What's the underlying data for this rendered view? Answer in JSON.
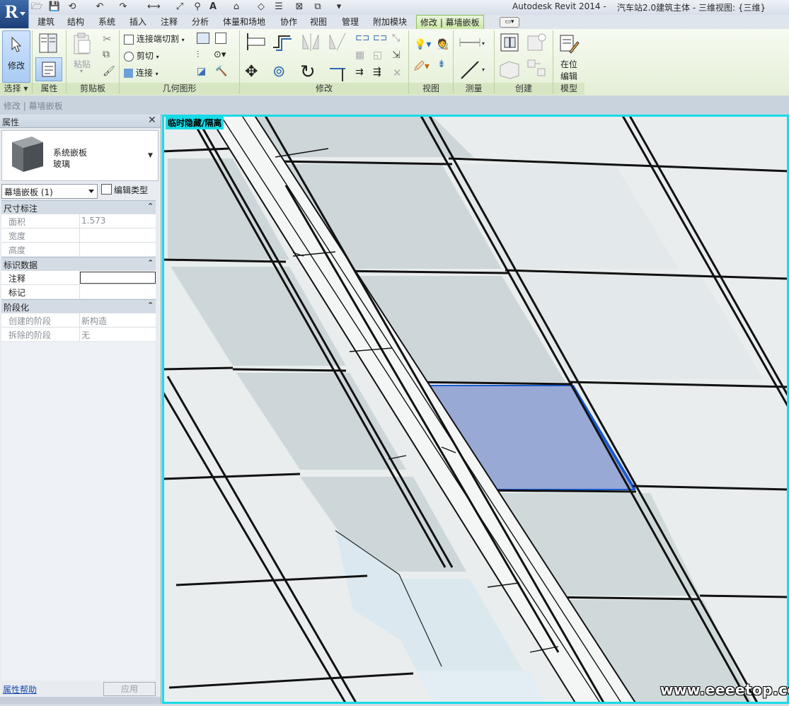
{
  "window": {
    "app_title": "Autodesk Revit 2014 -",
    "file_title": "汽车站2.0建筑主体 - 三维视图: {三维}"
  },
  "app_button": {
    "letter": "R"
  },
  "tabs": [
    {
      "label": "建筑"
    },
    {
      "label": "结构"
    },
    {
      "label": "系统"
    },
    {
      "label": "插入"
    },
    {
      "label": "注释"
    },
    {
      "label": "分析"
    },
    {
      "label": "体量和场地"
    },
    {
      "label": "协作"
    },
    {
      "label": "视图"
    },
    {
      "label": "管理"
    },
    {
      "label": "附加模块"
    },
    {
      "label": "修改 | 幕墙嵌板"
    }
  ],
  "ribbon": {
    "select": {
      "button": "修改",
      "panel": "选择 ▾"
    },
    "properties": {
      "panel": "属性"
    },
    "clipboard": {
      "paste": "粘贴",
      "panel": "剪贴板"
    },
    "geometry": {
      "join_cut": "连接端切割",
      "cut": "剪切",
      "join": "连接",
      "panel": "几何图形"
    },
    "modify": {
      "panel": "修改"
    },
    "view": {
      "panel": "视图"
    },
    "measure": {
      "panel": "测量"
    },
    "create": {
      "panel": "创建"
    },
    "model": {
      "inplace_line1": "在位",
      "inplace_line2": "编辑",
      "panel": "模型"
    }
  },
  "breadcrumb": "修改 | 幕墙嵌板",
  "properties": {
    "title": "属性",
    "type_family": "系统嵌板",
    "type_name": "玻璃",
    "instance_selector": "幕墙嵌板 (1)",
    "edit_type": "编辑类型",
    "groups": [
      {
        "name": "尺寸标注",
        "rows": [
          {
            "key": "面积",
            "value": "1.573"
          },
          {
            "key": "宽度",
            "value": ""
          },
          {
            "key": "高度",
            "value": ""
          }
        ]
      },
      {
        "name": "标识数据",
        "rows": [
          {
            "key": "注释",
            "value": ""
          },
          {
            "key": "标记",
            "value": ""
          }
        ]
      },
      {
        "name": "阶段化",
        "rows": [
          {
            "key": "创建的阶段",
            "value": "新构造"
          },
          {
            "key": "拆除的阶段",
            "value": "无"
          }
        ]
      }
    ],
    "help_link": "属性帮助",
    "apply_button": "应用"
  },
  "viewport": {
    "mode_label": "临时隐藏/隔离",
    "highlight_color": "#17dbe6",
    "selected_panel_color": "#98a9d6"
  },
  "watermark": "www.eeeetop.com"
}
